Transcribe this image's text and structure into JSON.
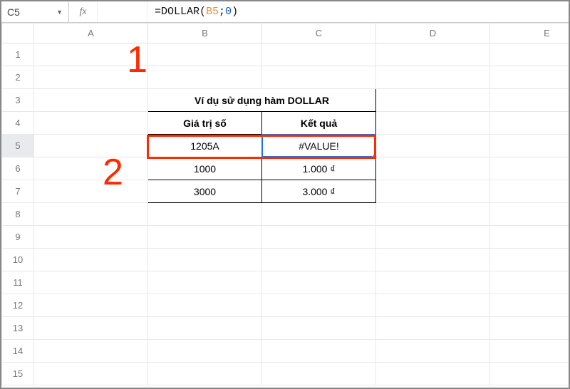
{
  "formulaBar": {
    "nameBox": "C5",
    "formula": {
      "prefix": "=DOLLAR(",
      "ref": "B5",
      "sep": ";",
      "num": "0",
      "suffix": ")"
    },
    "raw": "=DOLLAR(B5;0)"
  },
  "columns": [
    "A",
    "B",
    "C",
    "D",
    "E"
  ],
  "rowCount": 15,
  "selectedRow": 5,
  "dataTable": {
    "title": "Ví dụ sử dụng hàm DOLLAR",
    "headers": {
      "col1": "Giá trị số",
      "col2": "Kết quả"
    },
    "rows": [
      {
        "value": "1205A",
        "result": "#VALUE!"
      },
      {
        "value": "1000",
        "result": "1.000 ₫"
      },
      {
        "value": "3000",
        "result": "3.000 ₫"
      }
    ]
  },
  "annotations": {
    "label1": "1",
    "label2": "2"
  }
}
